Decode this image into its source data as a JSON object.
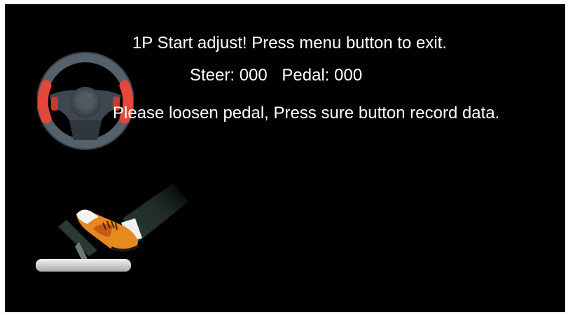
{
  "screen": {
    "title": "1P Start adjust! Press menu button to exit.",
    "readout": {
      "steer": "Steer: 000",
      "pedal": "Pedal: 000"
    },
    "hint": "Please loosen pedal,  Press sure button record data."
  },
  "icons": {
    "wheel": "steering-wheel-icon",
    "pedal": "foot-on-pedal-icon"
  },
  "colors": {
    "background": "#000000",
    "text": "#ffffff",
    "wheel_rim": "#4a5560",
    "wheel_grip": "#e5473a",
    "shoe": "#e58a1f",
    "pedal_base": "#e0e0e0"
  }
}
